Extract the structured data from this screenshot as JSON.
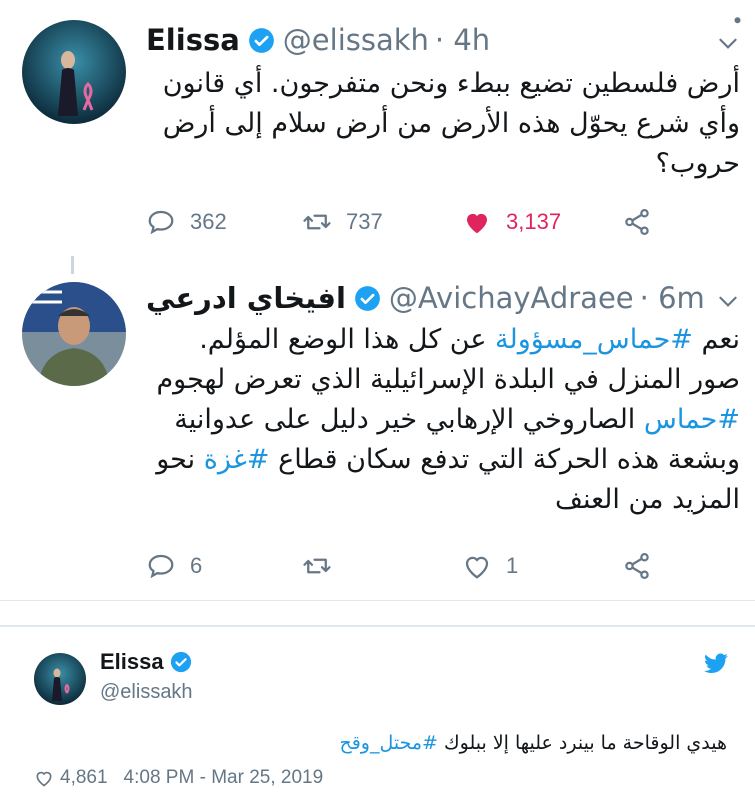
{
  "tweets": [
    {
      "name": "Elissa",
      "handle": "@elissakh",
      "time": "· 4h",
      "text": "أرض فلسطين تضيع ببطء ونحن متفرجون. أي قانون وأي شرع يحوّل هذه الأرض من أرض سلام إلى أرض حروب؟",
      "replies": "362",
      "retweets": "737",
      "likes": "3,137"
    },
    {
      "name": "افيخاي ادرعي",
      "handle": "@AvichayAdraee",
      "time": "· 6m",
      "line1_pre": "نعم ",
      "line1_tag": "#حماس_مسؤولة",
      "line1_post": " عن كل هذا الوضع المؤلم.",
      "line2": "صور المنزل في البلدة الإسرائيلية الذي تعرض لهجوم",
      "line3_tag": "#حماس",
      "line3_post": " الصاروخي الإرهابي خير دليل على عدوانية",
      "line4_pre": "وبشعة هذه الحركة التي تدفع سكان قطاع ",
      "line4_tag": "#غزة",
      "line4_post": " نحو",
      "line5": "المزيد من العنف",
      "replies": "6",
      "likes": "1"
    }
  ],
  "embed": {
    "name": "Elissa",
    "handle": "@elissakh",
    "text_pre": "هيدي الوقاحة ما بينرد عليها إلا ببلوك ",
    "text_tag": "#محتل_وقح",
    "likes": "4,861",
    "timestamp": "4:08 PM - Mar 25, 2019"
  },
  "colors": {
    "verified": "#1da1f2",
    "hashtag": "#1b95e0",
    "like": "#e0245e",
    "muted": "#657786"
  }
}
